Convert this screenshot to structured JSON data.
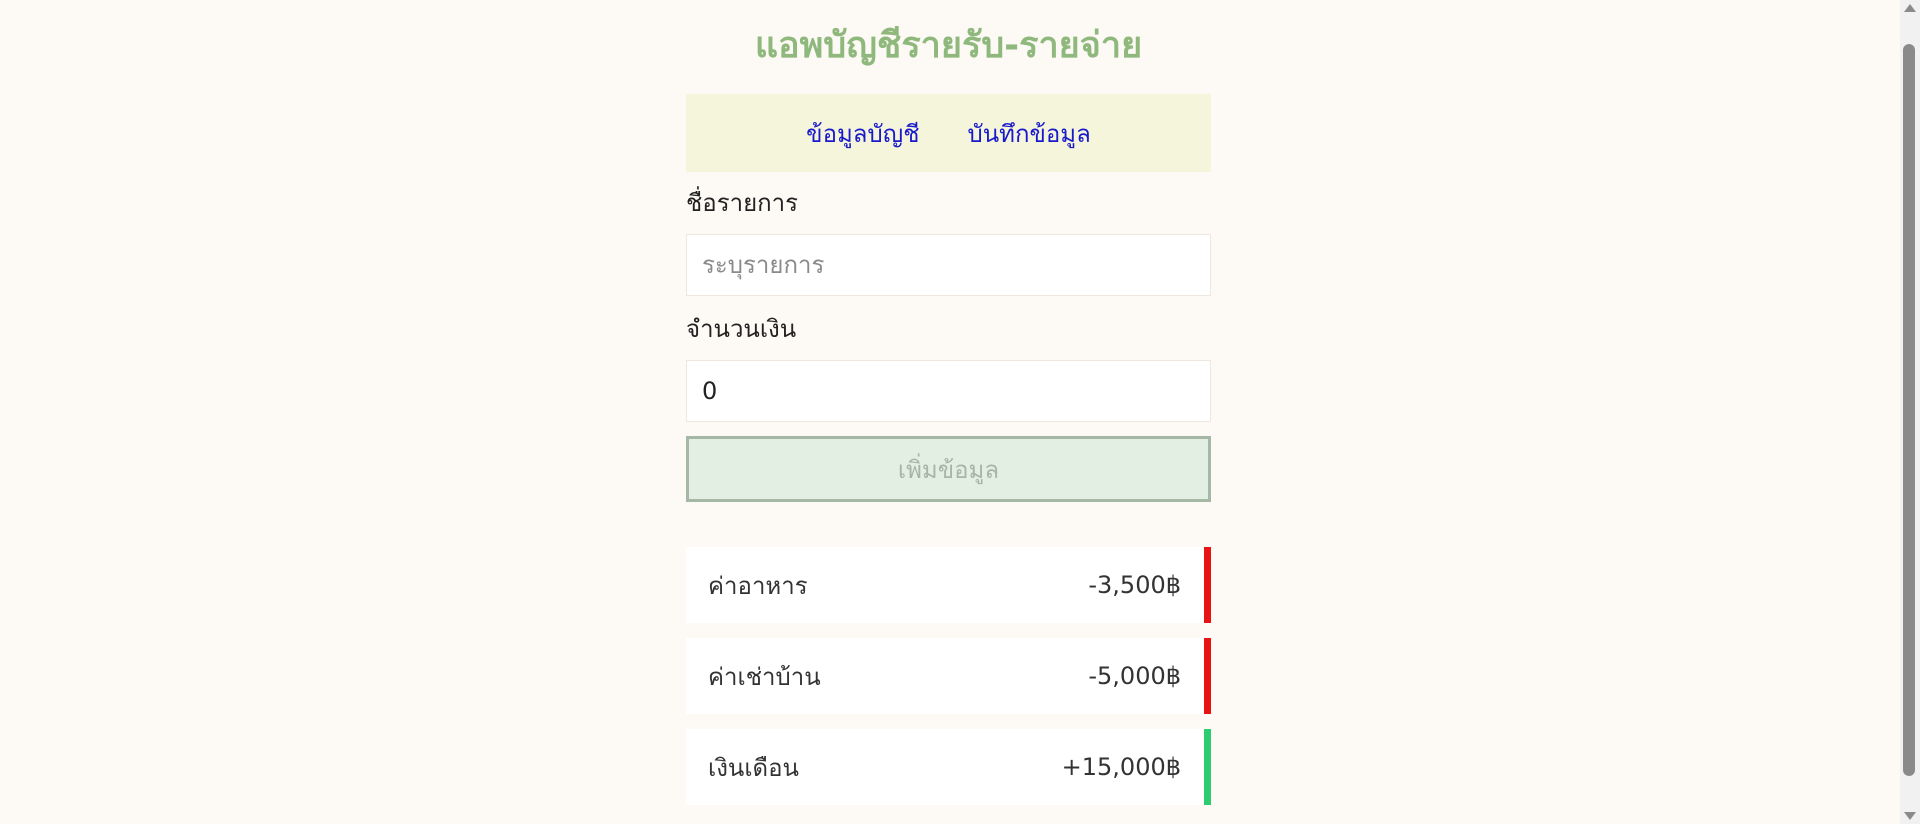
{
  "app": {
    "title": "แอพบัญชีรายรับ-รายจ่าย"
  },
  "nav": {
    "items": [
      {
        "label": "ข้อมูลบัญชี"
      },
      {
        "label": "บันทึกข้อมูล"
      }
    ]
  },
  "form": {
    "name_label": "ชื่อรายการ",
    "name_placeholder": "ระบุรายการ",
    "name_value": "",
    "amount_label": "จำนวนเงิน",
    "amount_value": "0",
    "submit_label": "เพิ่มข้อมูล"
  },
  "transactions": [
    {
      "title": "ค่าอาหาร",
      "amount": "-3,500฿",
      "color": "#e81414"
    },
    {
      "title": "ค่าเช่าบ้าน",
      "amount": "-5,000฿",
      "color": "#e81414"
    },
    {
      "title": "เงินเดือน",
      "amount": "+15,000฿",
      "color": "#2ecc71"
    }
  ],
  "colors": {
    "title": "#8fb87d",
    "nav_bg": "#f5f5dc",
    "nav_link": "#1a1acb",
    "expense": "#e81414",
    "income": "#2ecc71"
  }
}
